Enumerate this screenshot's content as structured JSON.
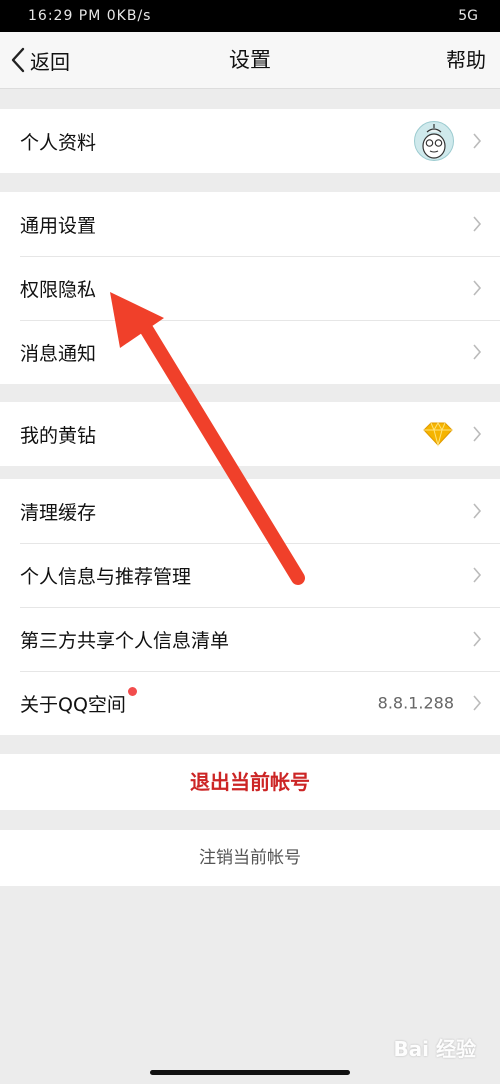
{
  "status_bar": {
    "left": "16:29 PM 0KB/s",
    "right": "5G"
  },
  "nav": {
    "back_label": "返回",
    "title": "设置",
    "help_label": "帮助"
  },
  "groups": [
    {
      "items": [
        {
          "label": "个人资料",
          "extra": "avatar"
        }
      ]
    },
    {
      "items": [
        {
          "label": "通用设置"
        },
        {
          "label": "权限隐私"
        },
        {
          "label": "消息通知"
        }
      ]
    },
    {
      "items": [
        {
          "label": "我的黄钻",
          "extra": "diamond-icon"
        }
      ]
    },
    {
      "items": [
        {
          "label": "清理缓存"
        },
        {
          "label": "个人信息与推荐管理"
        },
        {
          "label": "第三方共享个人信息清单"
        },
        {
          "label": "关于QQ空间",
          "version": "8.8.1.288",
          "badge": "red-dot"
        }
      ]
    }
  ],
  "actions": {
    "logout_label": "退出当前帐号",
    "cancel_account_label": "注销当前帐号"
  },
  "colors": {
    "logout_red": "#cc2525",
    "arrow_red": "#f0402a",
    "diamond_gold": "#f5b400",
    "background": "#ececec"
  },
  "watermark": "Bai 经验"
}
